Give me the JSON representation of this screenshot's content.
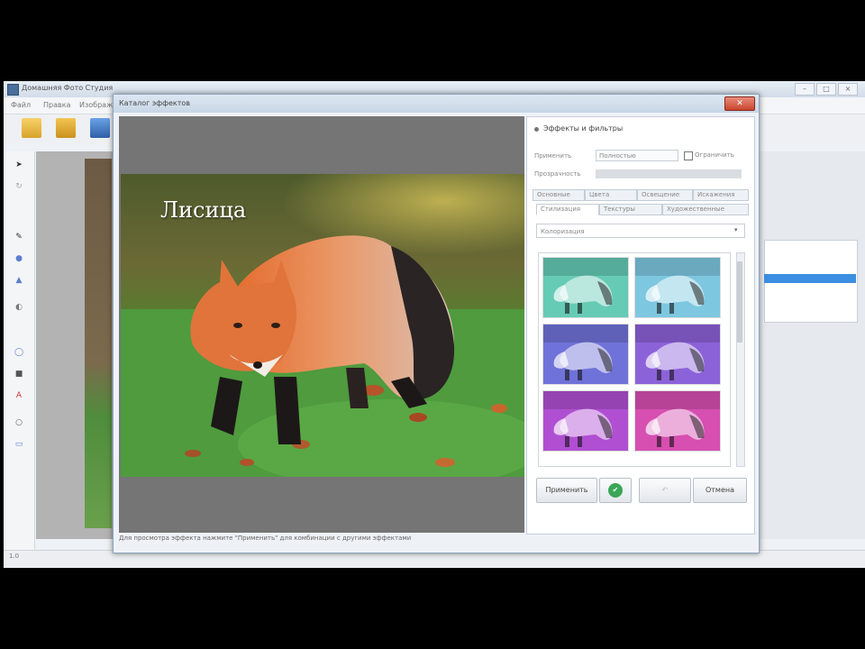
{
  "app": {
    "title": "Домашняя Фото Студия",
    "menu": [
      "Файл",
      "Правка",
      "Изображение"
    ],
    "status_text": "1.0"
  },
  "dialog": {
    "title": "Каталог эффектов",
    "close_label": "✕",
    "photo_caption": "Лисица",
    "panel": {
      "header": "Эффекты и фильтры",
      "field1_label": "Применить",
      "field1_value": "Полностью",
      "checkbox_label": "Ограничить",
      "field2_label": "Прозрачность",
      "tabs_row1": [
        "Основные",
        "Цвета",
        "Освещение",
        "Искажения"
      ],
      "tabs_row2": [
        "Стилизация",
        "Текстуры",
        "Художественные"
      ],
      "dropdown_value": "Колоризация",
      "thumbs": [
        {
          "color": "#66cbb5"
        },
        {
          "color": "#7dc7e0"
        },
        {
          "color": "#6f72d8"
        },
        {
          "color": "#8c62d9"
        },
        {
          "color": "#b04fd2"
        },
        {
          "color": "#d64fb1"
        }
      ],
      "buttons": {
        "apply": "Применить",
        "ok_icon": "✔",
        "reset": "↶",
        "cancel": "Отмена"
      }
    },
    "status_text": "Для просмотра эффекта нажмите \"Применить\" для комбинации с другими эффектами"
  }
}
